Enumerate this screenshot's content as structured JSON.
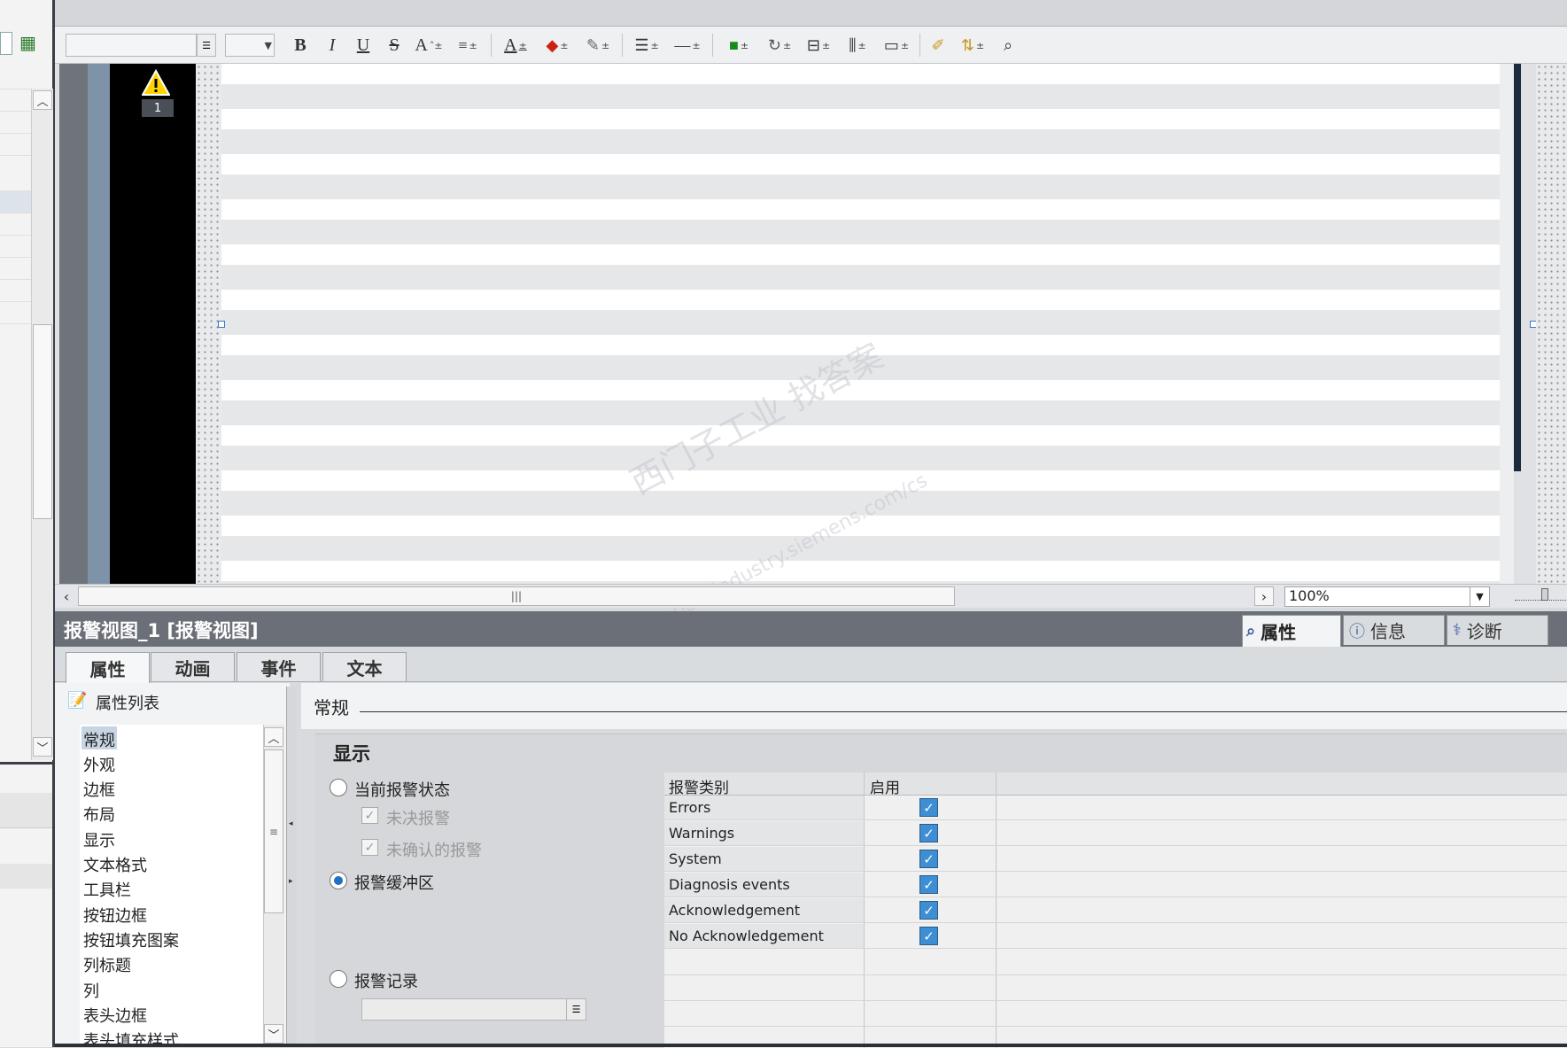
{
  "toolbar": {
    "font_name": "",
    "font_size": "",
    "bold": "B",
    "italic": "I",
    "underline": "U",
    "strike": "S",
    "font_grow": "A",
    "font_color": "A"
  },
  "canvas": {
    "alarm_indicator_label": "1",
    "watermark_cn": "西门子工业 找答案",
    "watermark_url": "support.industry.siemens.com/cs",
    "zoom_value": "100%"
  },
  "properties": {
    "object_title": "报警视图_1 [报警视图]",
    "inspector_tabs": [
      "属性",
      "信息",
      "诊断"
    ],
    "tabs": [
      "属性",
      "动画",
      "事件",
      "文本"
    ],
    "list_header": "属性列表",
    "list_items": [
      "常规",
      "外观",
      "边框",
      "布局",
      "显示",
      "文本格式",
      "工具栏",
      "按钮边框",
      "按钮填充图案",
      "列标题",
      "列",
      "表头边框",
      "表头填充样式"
    ],
    "section_title": "常规",
    "group_title": "显示",
    "options": {
      "current_state": "当前报警状态",
      "pending": "未决报警",
      "unacknowledged": "未确认的报警",
      "buffer": "报警缓冲区",
      "log": "报警记录",
      "log_value": ""
    },
    "class_table": {
      "col_class": "报警类别",
      "col_enabled": "启用",
      "rows": [
        {
          "name": "Errors",
          "enabled": true
        },
        {
          "name": "Warnings",
          "enabled": true
        },
        {
          "name": "System",
          "enabled": true
        },
        {
          "name": "Diagnosis events",
          "enabled": true
        },
        {
          "name": "Acknowledgement",
          "enabled": true
        },
        {
          "name": "No Acknowledgement",
          "enabled": true
        }
      ]
    }
  }
}
